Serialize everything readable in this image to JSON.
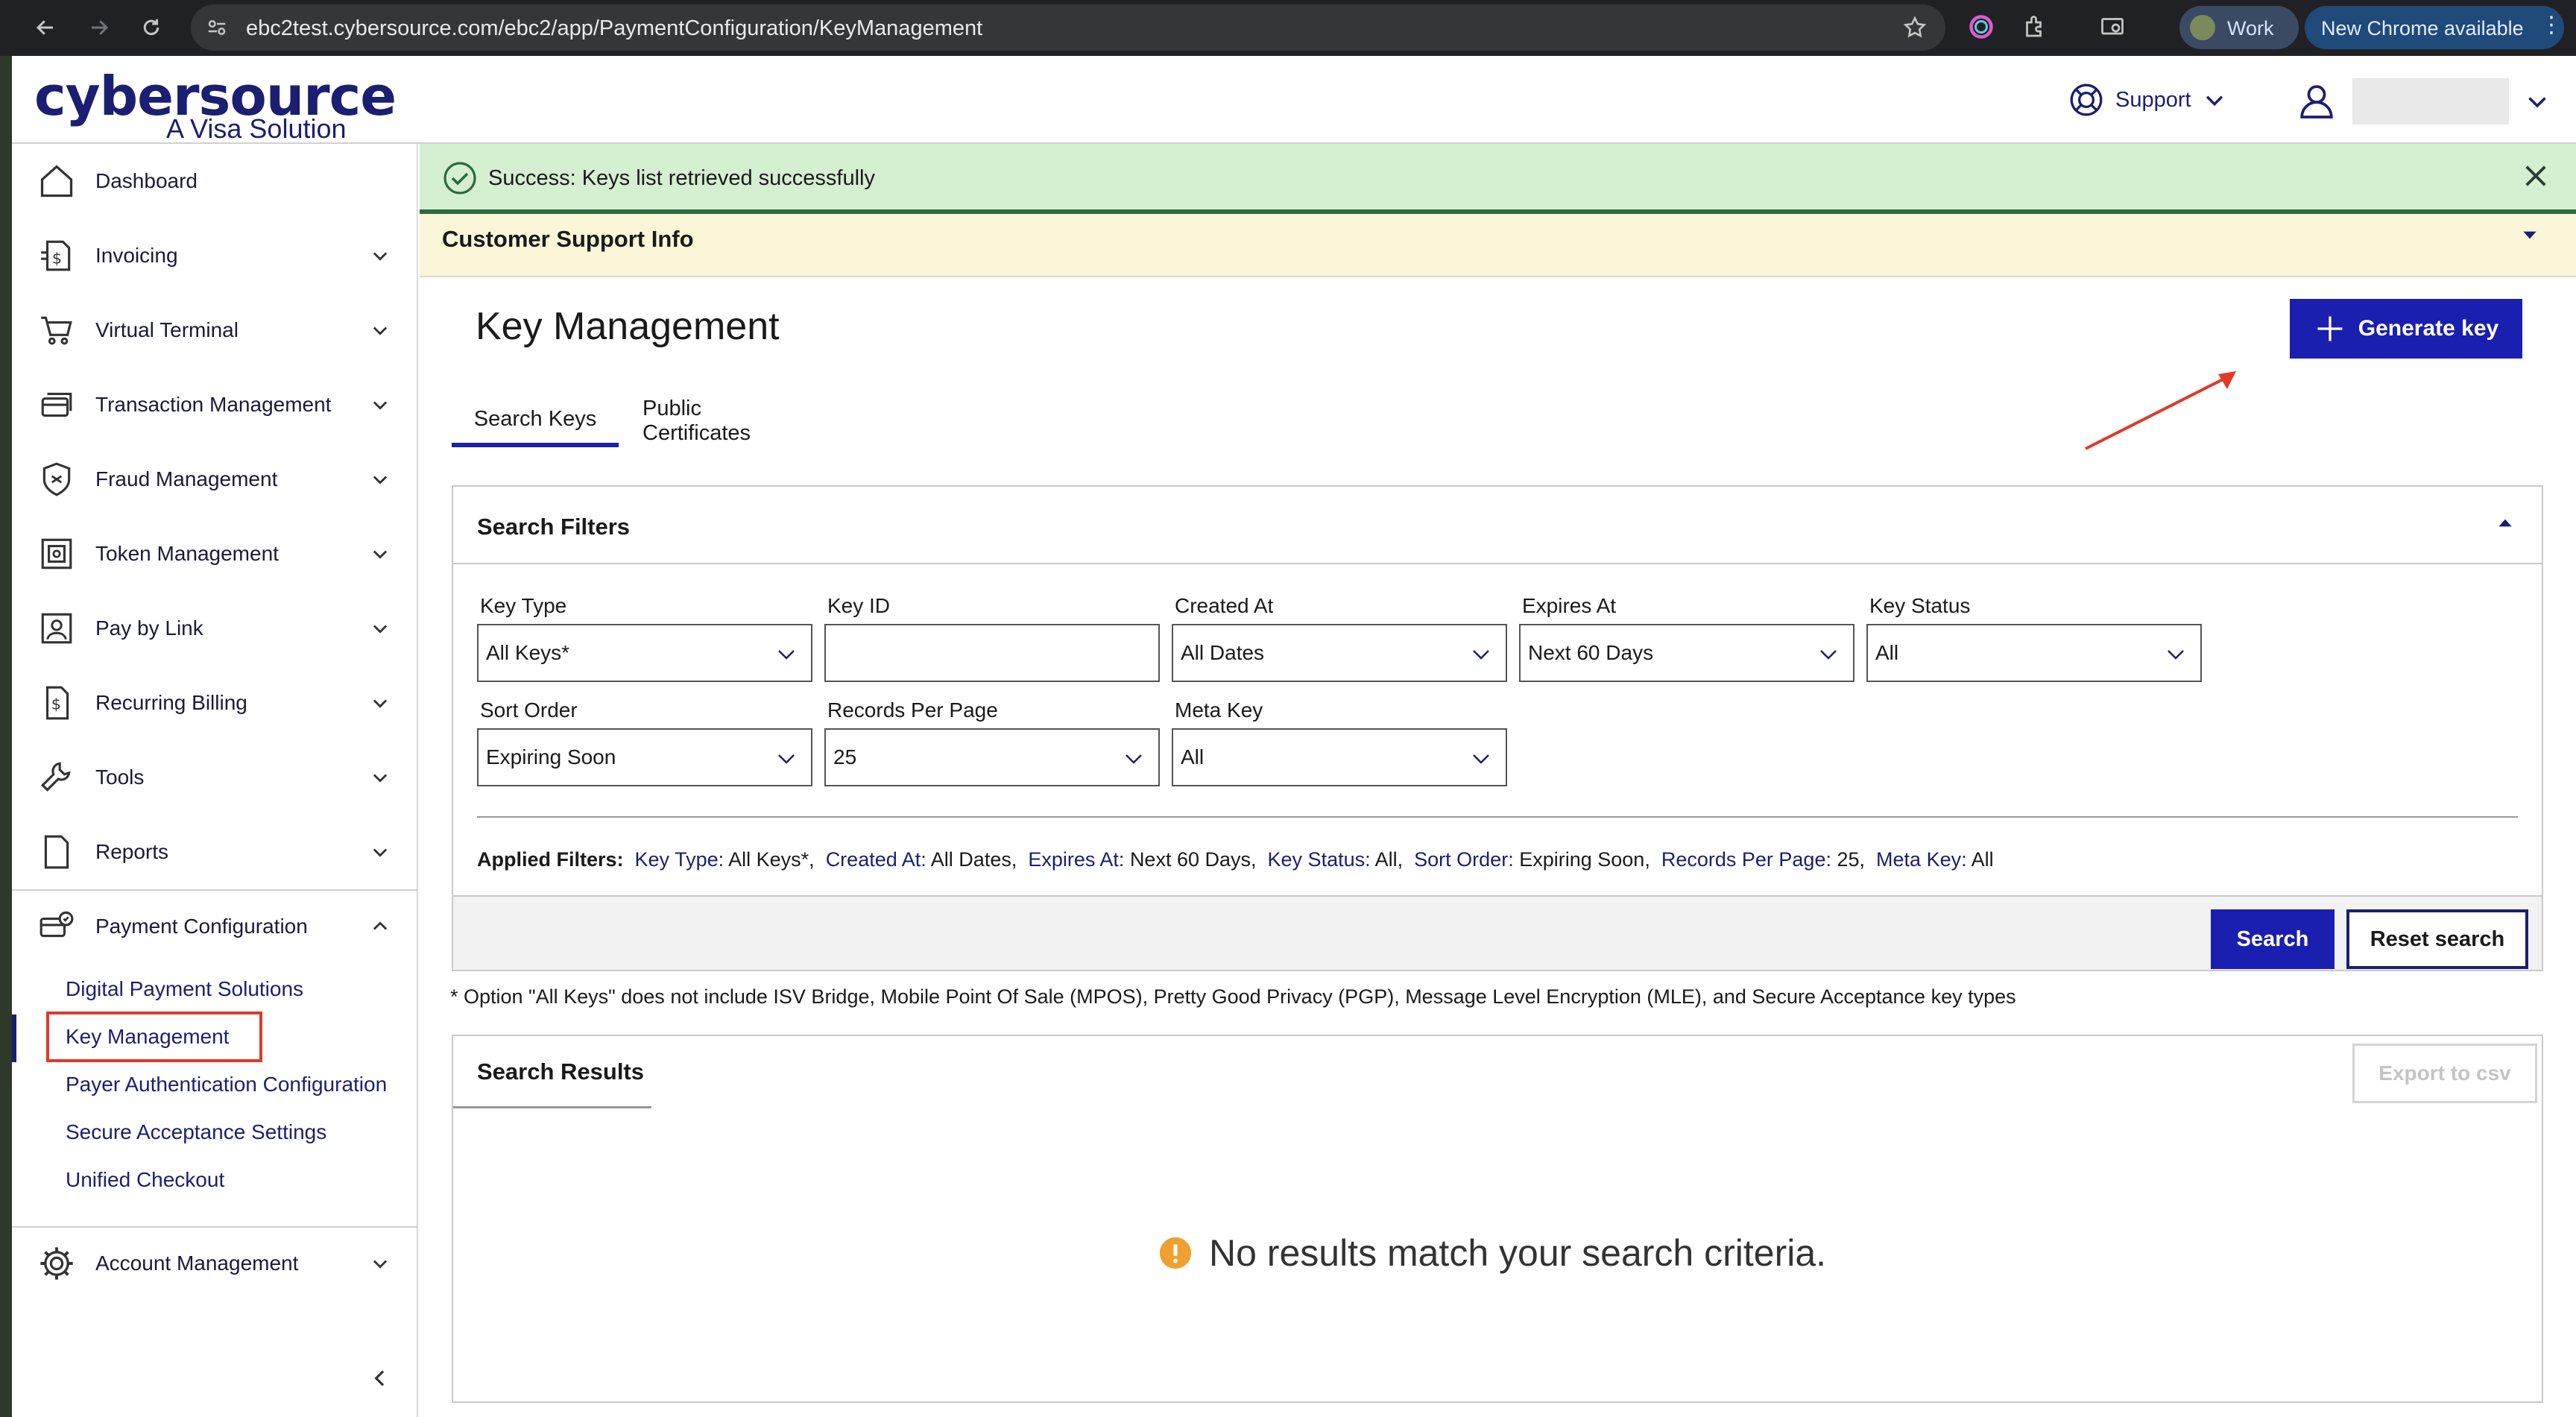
{
  "browser": {
    "url": "ebc2test.cybersource.com/ebc2/app/PaymentConfiguration/KeyManagement",
    "profile_label": "Work",
    "update_label": "New Chrome available"
  },
  "header": {
    "logo_main": "cybersource",
    "logo_sub": "A Visa Solution",
    "support_label": "Support"
  },
  "sidebar": {
    "items": [
      {
        "label": "Dashboard",
        "icon": "home-icon"
      },
      {
        "label": "Invoicing",
        "icon": "invoice-icon"
      },
      {
        "label": "Virtual Terminal",
        "icon": "cart-icon"
      },
      {
        "label": "Transaction Management",
        "icon": "cards-icon"
      },
      {
        "label": "Fraud Management",
        "icon": "shield-icon"
      },
      {
        "label": "Token Management",
        "icon": "token-icon"
      },
      {
        "label": "Pay by Link",
        "icon": "paylink-icon"
      },
      {
        "label": "Recurring Billing",
        "icon": "recurring-icon"
      },
      {
        "label": "Tools",
        "icon": "wrench-icon"
      },
      {
        "label": "Reports",
        "icon": "document-icon"
      },
      {
        "label": "Payment Configuration",
        "icon": "payment-config-icon"
      }
    ],
    "sub_items": [
      "Digital Payment Solutions",
      "Key Management",
      "Payer Authentication Configuration",
      "Secure Acceptance Settings",
      "Unified Checkout"
    ],
    "account": "Account Management"
  },
  "banner": {
    "success": "Success: Keys list retrieved successfully",
    "support_info": "Customer Support Info"
  },
  "main": {
    "title": "Key Management",
    "generate_key": "Generate key",
    "tabs": [
      "Search Keys",
      "Public Certificates"
    ]
  },
  "filters": {
    "title": "Search Filters",
    "key_type": {
      "label": "Key Type",
      "value": "All Keys*"
    },
    "key_id": {
      "label": "Key ID",
      "value": ""
    },
    "created_at": {
      "label": "Created At",
      "value": "All Dates"
    },
    "expires_at": {
      "label": "Expires At",
      "value": "Next 60 Days"
    },
    "key_status": {
      "label": "Key Status",
      "value": "All"
    },
    "sort_order": {
      "label": "Sort Order",
      "value": "Expiring Soon"
    },
    "records_per_page": {
      "label": "Records Per Page",
      "value": "25"
    },
    "meta_key": {
      "label": "Meta Key",
      "value": "All"
    },
    "applied_label": "Applied Filters:",
    "applied": [
      {
        "k": "Key Type:",
        "v": "All Keys*,"
      },
      {
        "k": "Created At:",
        "v": "All Dates,"
      },
      {
        "k": "Expires At:",
        "v": "Next 60 Days,"
      },
      {
        "k": "Key Status:",
        "v": "All,"
      },
      {
        "k": "Sort Order:",
        "v": "Expiring Soon,"
      },
      {
        "k": "Records Per Page:",
        "v": "25,"
      },
      {
        "k": "Meta Key:",
        "v": "All"
      }
    ],
    "search_btn": "Search",
    "reset_btn": "Reset search"
  },
  "footnote": "* Option \"All Keys\" does not include ISV Bridge, Mobile Point Of Sale (MPOS), Pretty Good Privacy (PGP), Message Level Encryption (MLE), and Secure Acceptance key types",
  "results": {
    "title": "Search Results",
    "export_btn": "Export to csv",
    "empty": "No results match your search criteria."
  },
  "colors": {
    "brand": "#1a1f71",
    "primary_button": "#1a1fb0",
    "success_bg": "#d5efd1",
    "warning_bg": "#fbf6d8",
    "annotation": "#e03a2b"
  }
}
